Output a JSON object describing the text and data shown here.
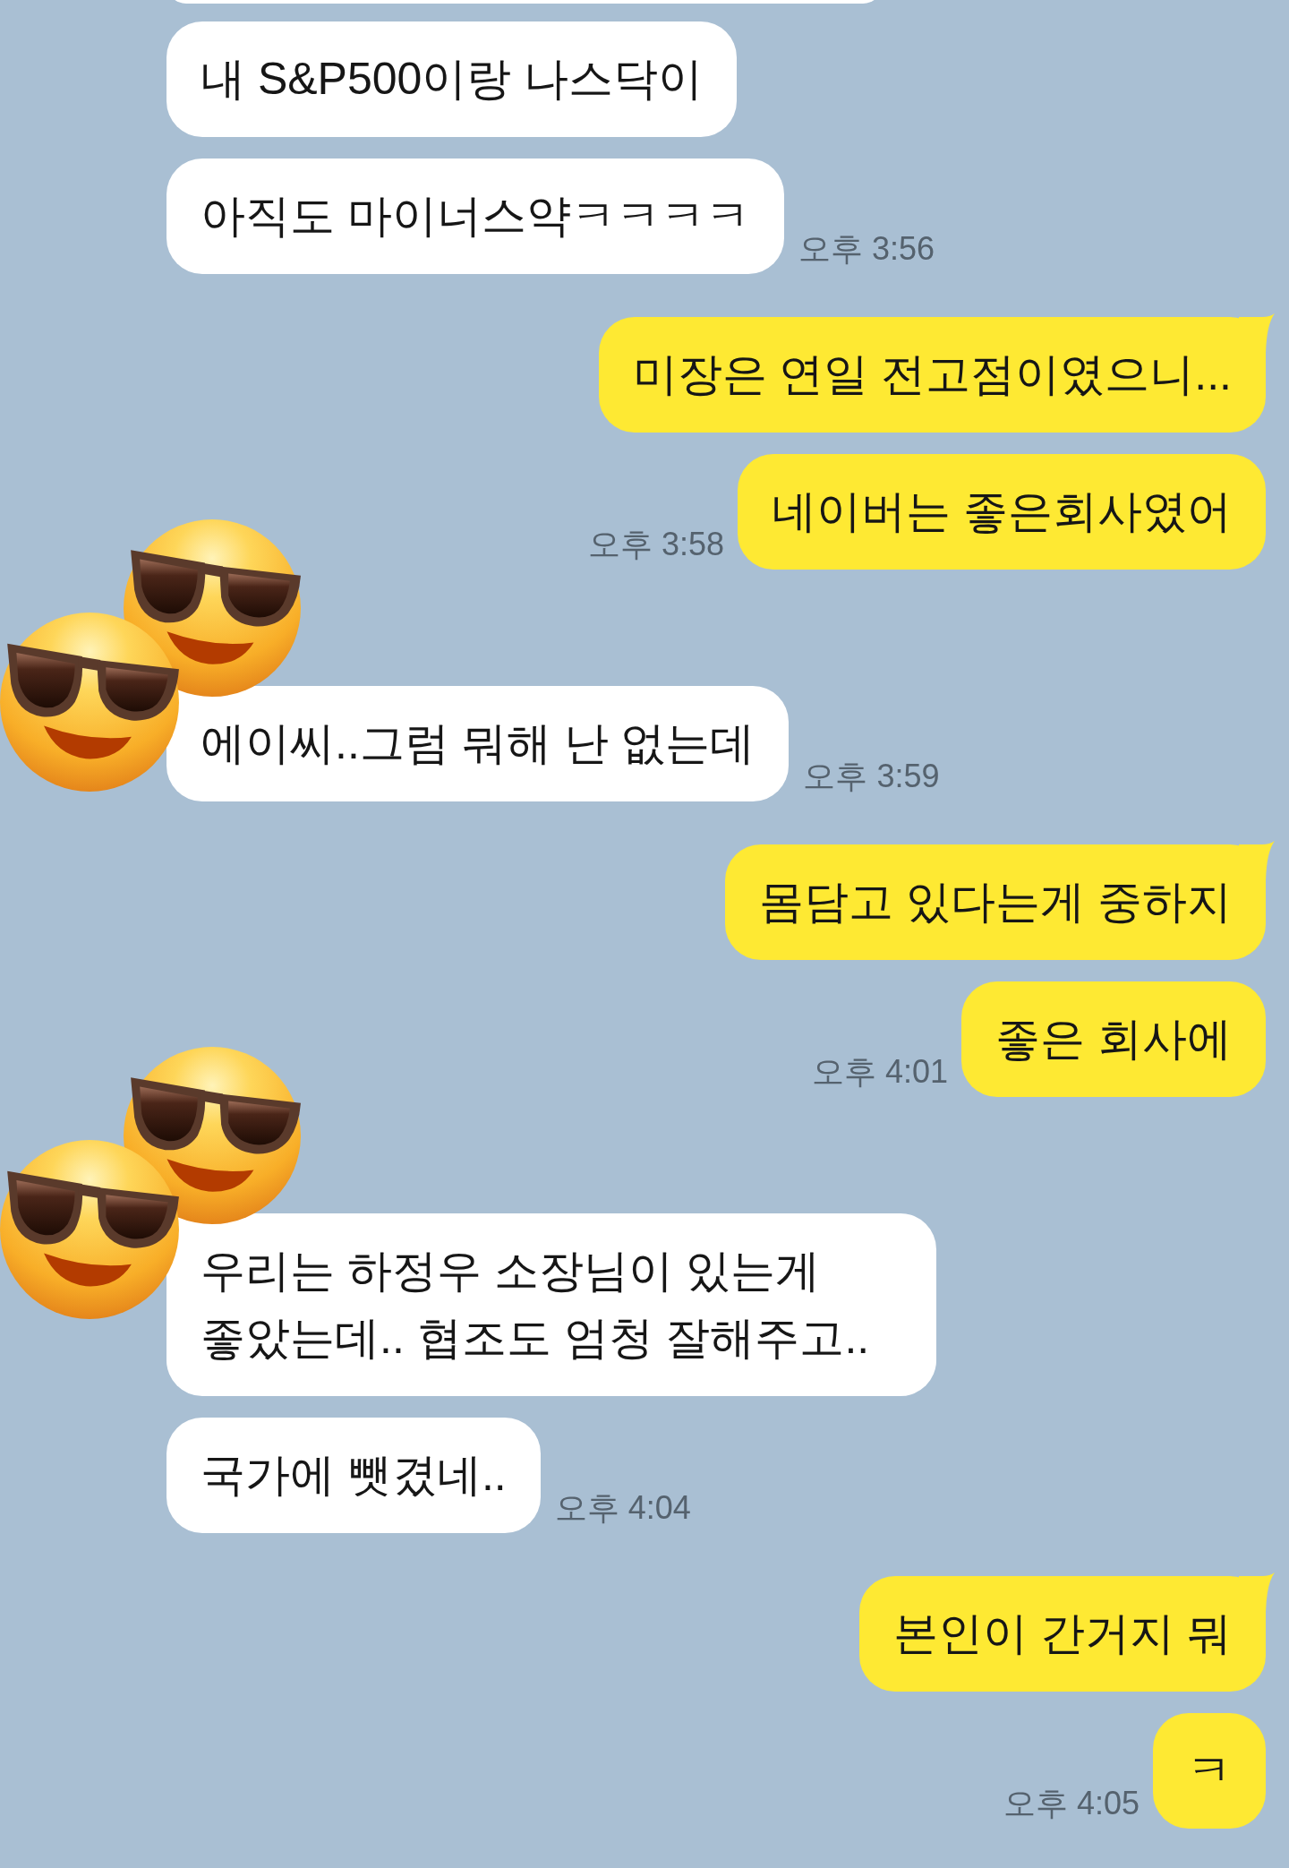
{
  "partial_bubble_above": true,
  "groups": [
    {
      "kind": "received",
      "messages": [
        "내 S&P500이랑 나스닥이",
        "아직도 마이너스약ㅋㅋㅋㅋ"
      ],
      "time": "오후 3:56"
    },
    {
      "kind": "sent",
      "messages": [
        "미장은 연일 전고점이였으니...",
        "네이버는 좋은회사였어"
      ],
      "time": "오후 3:58"
    },
    {
      "kind": "received",
      "avatar": true,
      "messages": [
        "에이씨..그럼 뭐해 난 없는데"
      ],
      "time": "오후 3:59"
    },
    {
      "kind": "sent",
      "messages": [
        "몸담고 있다는게 중하지",
        "좋은 회사에"
      ],
      "time": "오후 4:01"
    },
    {
      "kind": "received",
      "avatar": true,
      "messages": [
        "우리는 하정우 소장님이 있는게 좋았는데.. 협조도 엄청 잘해주고..",
        "국가에 뺏겼네.."
      ],
      "time": "오후 4:04"
    },
    {
      "kind": "sent",
      "messages": [
        "본인이 간거지 뭐",
        "ㅋ"
      ],
      "time": "오후 4:05"
    }
  ]
}
